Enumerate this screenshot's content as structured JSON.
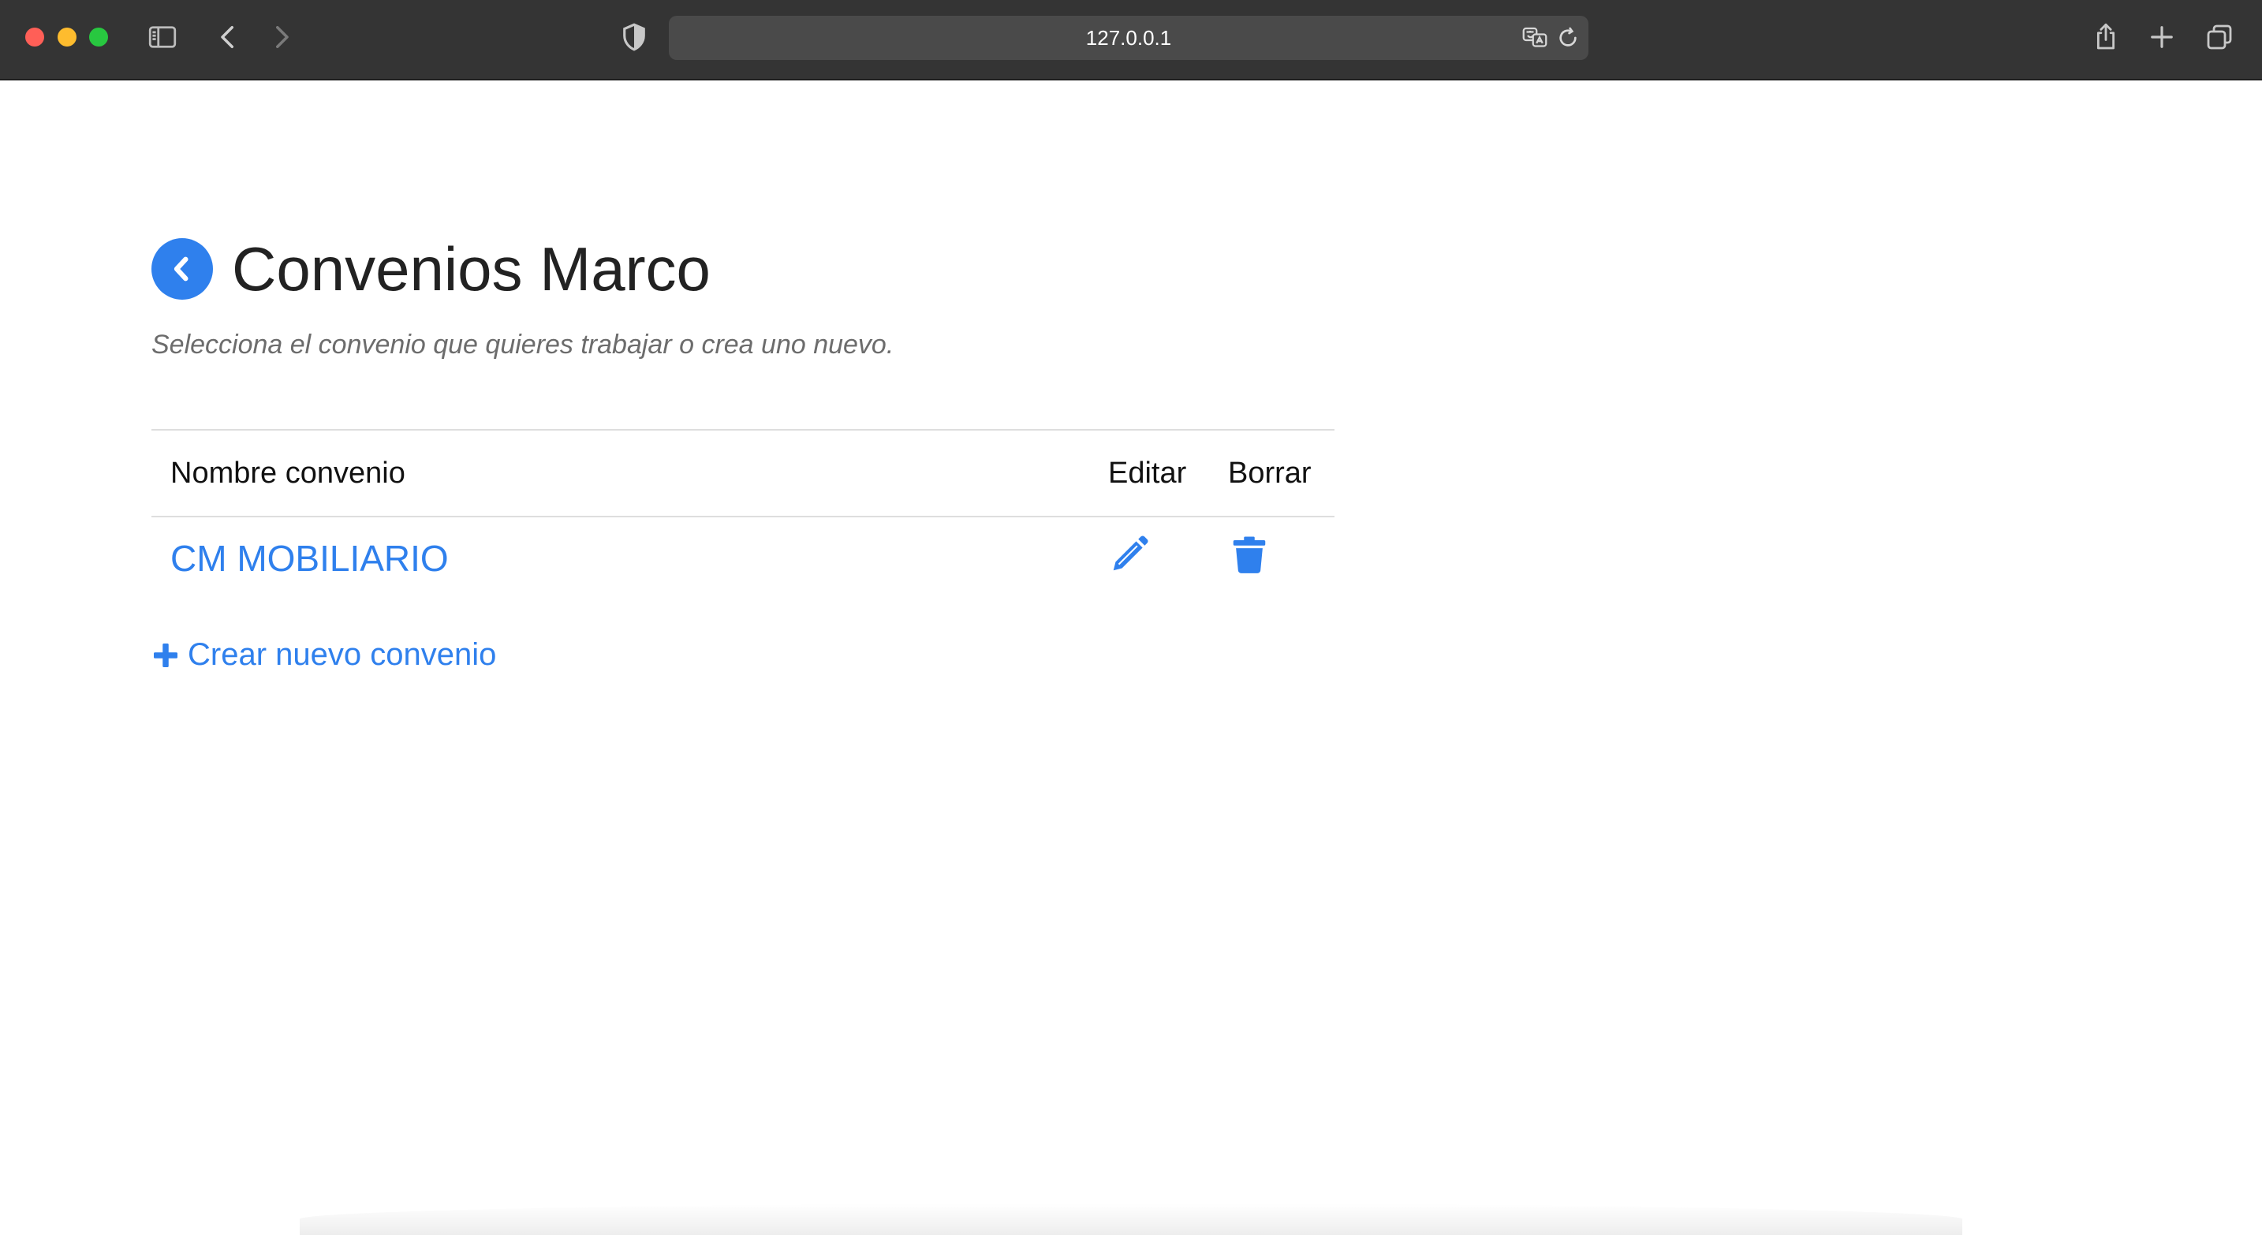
{
  "browser": {
    "url": "127.0.0.1"
  },
  "page": {
    "title": "Convenios Marco",
    "subtitle": "Selecciona el convenio que quieres trabajar o crea uno nuevo.",
    "table": {
      "headers": {
        "name": "Nombre convenio",
        "edit": "Editar",
        "delete": "Borrar"
      },
      "rows": [
        {
          "name": "CM MOBILIARIO"
        }
      ]
    },
    "create_label": "Crear nuevo convenio"
  },
  "colors": {
    "accent": "#2f80ed",
    "toolbar": "#343434"
  },
  "icons": {
    "back": "chevron-left-circle-icon",
    "edit": "pencil-icon",
    "delete": "trash-icon",
    "create": "plus-icon"
  }
}
